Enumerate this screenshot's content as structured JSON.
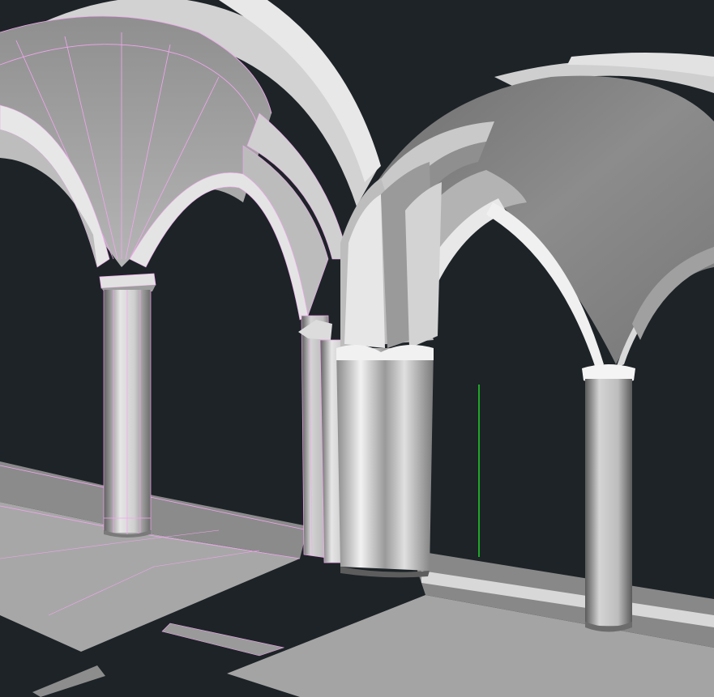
{
  "colors": {
    "background": "#1d2327",
    "wireframe": "#f3a6f0",
    "axis_y": "#22d128",
    "stone_light": "#e9e9e9",
    "stone_mid": "#a6a6a6",
    "stone_dark": "#5e5e5e"
  },
  "scene": {
    "left_bay": {
      "shading": "shaded-with-edges"
    },
    "right_bay": {
      "shading": "smooth-shaded"
    }
  }
}
